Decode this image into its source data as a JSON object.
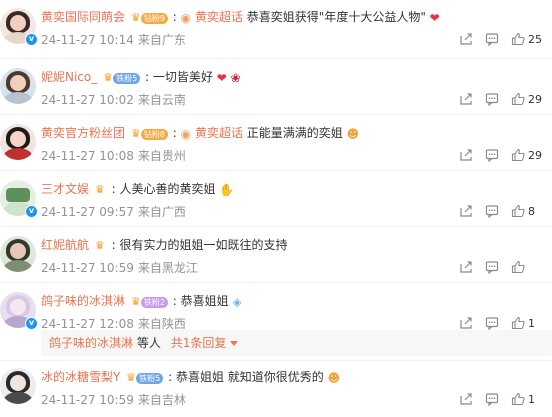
{
  "comments": [
    {
      "user": "黄奕国际同萌会",
      "fan_level": "钻粉9",
      "fan_color": "#f7a944",
      "colon": ":",
      "topic": "黄奕超话",
      "text": "恭喜奕姐获得\"年度十大公益人物\"",
      "emoji": "heart",
      "time": "24-11-27 10:14",
      "location": "来自广东",
      "likes": "25",
      "verified": "blue"
    },
    {
      "user": "妮妮Nico_",
      "fan_level": "铁粉5",
      "fan_color": "#6fa6e6",
      "colon": ":",
      "topic": "",
      "text": "一切皆美好",
      "emoji": "heart rose",
      "time": "24-11-27 10:02",
      "location": "来自云南",
      "likes": "29",
      "verified": "none"
    },
    {
      "user": "黄奕官方粉丝团",
      "fan_level": "钻粉8",
      "fan_color": "#f7a944",
      "colon": ":",
      "topic": "黄奕超话",
      "text": "正能量满满的奕姐",
      "emoji": "heart-eyes",
      "time": "24-11-27 10:08",
      "location": "来自贵州",
      "likes": "29",
      "verified": "none"
    },
    {
      "user": "三才文娱",
      "fan_level": "",
      "fan_color": "#f7a944",
      "colon": ":",
      "topic": "",
      "text": "人美心善的黄奕姐",
      "emoji": "thumbs-up",
      "time": "24-11-27 09:57",
      "location": "来自广西",
      "likes": "8",
      "verified": "blue"
    },
    {
      "user": "红妮航航",
      "fan_level": "",
      "fan_color": "#f7a944",
      "colon": ":",
      "topic": "",
      "text": "很有实力的姐姐一如既往的支持",
      "emoji": "",
      "time": "24-11-27 10:59",
      "location": "来自黑龙江",
      "likes": "",
      "verified": "none"
    },
    {
      "user": "鸽子味的冰淇淋",
      "fan_level": "铁粉2",
      "fan_color": "#c49bf0",
      "colon": ":",
      "topic": "",
      "text": "恭喜姐姐",
      "emoji": "diamond",
      "time": "24-11-27 12:08",
      "location": "来自陕西",
      "likes": "1",
      "verified": "blue"
    },
    {
      "user": "冰的冰糖雪梨Y",
      "fan_level": "铁粉5",
      "fan_color": "#6fa6e6",
      "colon": ":",
      "topic": "",
      "text": "恭喜姐姐 就知道你很优秀的",
      "emoji": "heart-eyes",
      "time": "24-11-27 10:59",
      "location": "来自吉林",
      "likes": "1",
      "verified": "none"
    }
  ],
  "reply": {
    "name": "鸽子味的冰淇淋",
    "middle": "等人",
    "count": "共1条回复"
  },
  "colors": {
    "accent": "#eb7350",
    "meta": "#939393",
    "verified_blue": "#1a96f0"
  },
  "icons": [
    "share-icon",
    "comment-icon",
    "like-icon",
    "crown-icon",
    "verified-icon"
  ]
}
